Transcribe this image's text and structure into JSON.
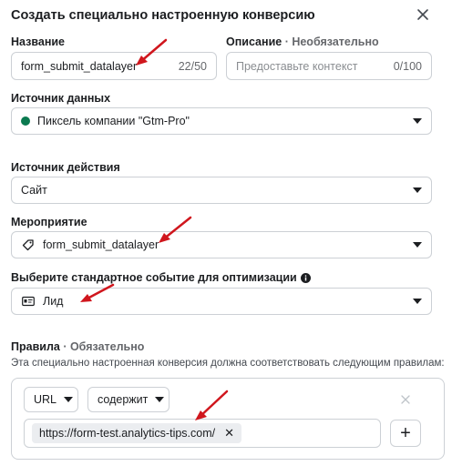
{
  "dialog": {
    "title": "Создать специально настроенную конверсию",
    "close_icon": "close-icon"
  },
  "name": {
    "label": "Название",
    "value": "form_submit_datalayer",
    "counter": "22/50"
  },
  "description": {
    "label": "Описание",
    "optional": "· Необязательно",
    "placeholder": "Предоставьте контекст",
    "counter": "0/100"
  },
  "data_source": {
    "label": "Источник данных",
    "value": "Пиксель компании \"Gtm-Pro\"",
    "status_color": "#0b7a50"
  },
  "action_source": {
    "label": "Источник действия",
    "value": "Сайт"
  },
  "event": {
    "label": "Мероприятие",
    "value": "form_submit_datalayer",
    "icon": "tag-icon"
  },
  "standard_event": {
    "label": "Выберите стандартное событие для оптимизации",
    "info_icon": "info-icon",
    "value": "Лид",
    "icon": "id-card-icon"
  },
  "rules": {
    "label": "Правила",
    "required": "· Обязательно",
    "description": "Эта специально настроенная конверсия должна соответствовать следующим правилам:",
    "field_select": "URL",
    "operator_select": "содержит",
    "url_chip": "https://form-test.analytics-tips.com/",
    "add_button": "+"
  },
  "annotation_color": "#d0161d"
}
